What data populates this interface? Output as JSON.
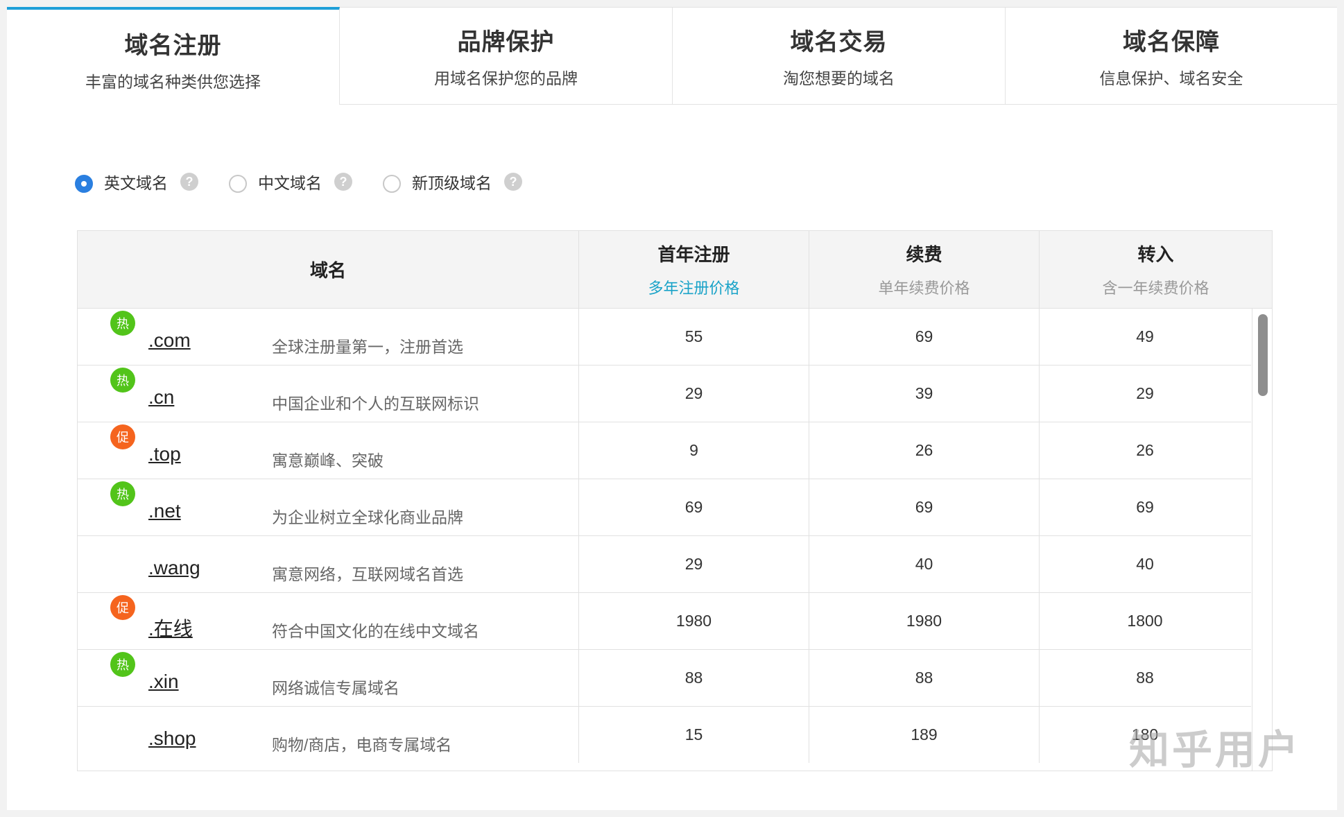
{
  "tabs": [
    {
      "title": "域名注册",
      "subtitle": "丰富的域名种类供您选择",
      "active": true
    },
    {
      "title": "品牌保护",
      "subtitle": "用域名保护您的品牌",
      "active": false
    },
    {
      "title": "域名交易",
      "subtitle": "淘您想要的域名",
      "active": false
    },
    {
      "title": "域名保障",
      "subtitle": "信息保护、域名安全",
      "active": false
    }
  ],
  "domain_types": [
    {
      "label": "英文域名",
      "checked": true
    },
    {
      "label": "中文域名",
      "checked": false
    },
    {
      "label": "新顶级域名",
      "checked": false
    }
  ],
  "help_glyph": "?",
  "table": {
    "headers": {
      "name": "域名",
      "first_year": {
        "title": "首年注册",
        "subtitle": "多年注册价格"
      },
      "renew": {
        "title": "续费",
        "subtitle": "单年续费价格"
      },
      "transfer": {
        "title": "转入",
        "subtitle": "含一年续费价格"
      }
    },
    "rows": [
      {
        "badge": "热",
        "badge_color": "#52c41a",
        "domain": ".com",
        "desc": "全球注册量第一，注册首选",
        "first_year": "55",
        "renew": "69",
        "transfer": "49"
      },
      {
        "badge": "热",
        "badge_color": "#52c41a",
        "domain": ".cn",
        "desc": "中国企业和个人的互联网标识",
        "first_year": "29",
        "renew": "39",
        "transfer": "29"
      },
      {
        "badge": "促",
        "badge_color": "#f5641e",
        "domain": ".top",
        "desc": "寓意巅峰、突破",
        "first_year": "9",
        "renew": "26",
        "transfer": "26"
      },
      {
        "badge": "热",
        "badge_color": "#52c41a",
        "domain": ".net",
        "desc": "为企业树立全球化商业品牌",
        "first_year": "69",
        "renew": "69",
        "transfer": "69"
      },
      {
        "badge": "",
        "badge_color": "",
        "domain": ".wang",
        "desc": "寓意网络，互联网域名首选",
        "first_year": "29",
        "renew": "40",
        "transfer": "40"
      },
      {
        "badge": "促",
        "badge_color": "#f5641e",
        "domain": ".在线",
        "desc": "符合中国文化的在线中文域名",
        "first_year": "1980",
        "renew": "1980",
        "transfer": "1800"
      },
      {
        "badge": "热",
        "badge_color": "#52c41a",
        "domain": ".xin",
        "desc": "网络诚信专属域名",
        "first_year": "88",
        "renew": "88",
        "transfer": "88"
      },
      {
        "badge": "",
        "badge_color": "",
        "domain": ".shop",
        "desc": "购物/商店，电商专属域名",
        "first_year": "15",
        "renew": "189",
        "transfer": "180"
      }
    ]
  },
  "watermark": "知乎用户",
  "colors": {
    "accent": "#1e9fd8",
    "radio_checked": "#2a7fe0",
    "hot": "#52c41a",
    "promo": "#f5641e"
  }
}
